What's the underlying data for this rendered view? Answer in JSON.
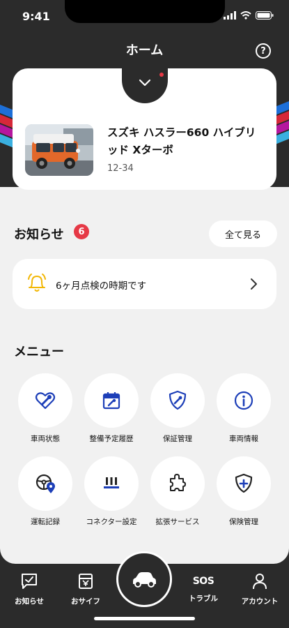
{
  "status": {
    "time": "9:41"
  },
  "header": {
    "title": "ホーム",
    "help_icon": "question-circle-icon"
  },
  "vehicle": {
    "name": "スズキ ハスラー660 ハイブリッド Xターボ",
    "plate": "12-34",
    "has_new_dot": true
  },
  "notices": {
    "title": "お知らせ",
    "count": "6",
    "see_all_label": "全て見る",
    "latest": {
      "text": "6ヶ月点検の時期です",
      "icon": "bell-icon"
    }
  },
  "menu": {
    "title": "メニュー",
    "items": [
      {
        "label": "車両状態",
        "icon": "heart-wrench-icon"
      },
      {
        "label": "整備予定履歴",
        "icon": "calendar-wrench-icon"
      },
      {
        "label": "保証管理",
        "icon": "shield-wrench-icon"
      },
      {
        "label": "車両情報",
        "icon": "info-icon"
      },
      {
        "label": "運転記録",
        "icon": "steering-location-icon"
      },
      {
        "label": "コネクター設定",
        "icon": "connector-icon"
      },
      {
        "label": "拡張サービス",
        "icon": "puzzle-icon"
      },
      {
        "label": "保険管理",
        "icon": "shield-plus-icon"
      }
    ]
  },
  "tabbar": {
    "items": [
      {
        "label": "お知らせ",
        "icon": "message-check-icon"
      },
      {
        "label": "おサイフ",
        "icon": "wallet-icon"
      },
      {
        "label": "",
        "icon": "car-icon"
      },
      {
        "label": "トラブル",
        "icon": "sos-icon",
        "glyph": "SOS"
      },
      {
        "label": "アカウント",
        "icon": "user-icon"
      }
    ]
  },
  "colors": {
    "dark": "#2b2b2b",
    "accent_blue": "#1d3fb8",
    "badge_red": "#e63946",
    "bell_yellow": "#f2b705"
  }
}
